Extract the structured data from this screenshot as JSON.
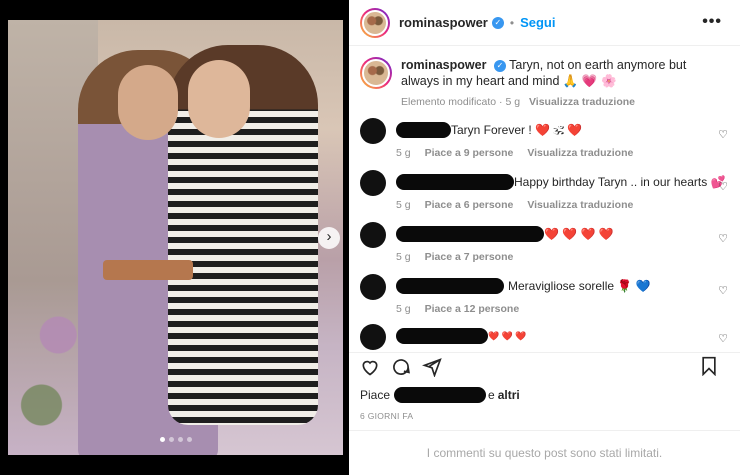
{
  "post": {
    "username": "rominaspower",
    "follow_label": "Segui",
    "separator": "•",
    "more_label": "•••"
  },
  "caption": {
    "username": "rominaspower",
    "text": "Taryn, not on earth anymore but always in my heart and mind 🙏 💗 🌸",
    "meta": "Elemento modificato · 5 g",
    "translate": "Visualizza traduzione"
  },
  "comments": [
    {
      "text": "Taryn Forever ! ❤️ 🕉 ❤️",
      "time": "5 g",
      "likes": "Piace a 9 persone",
      "translate": "Visualizza traduzione"
    },
    {
      "text": "Happy birthday Taryn .. in our hearts 💕",
      "time": "5 g",
      "likes": "Piace a 6 persone",
      "translate": "Visualizza traduzione"
    },
    {
      "text": "❤️ ❤️ ❤️ ❤️",
      "time": "5 g",
      "likes": "Piace a 7 persone",
      "translate": ""
    },
    {
      "text": "Meravigliose sorelle 🌹 💙",
      "time": "5 g",
      "likes": "Piace a 12 persone",
      "translate": ""
    },
    {
      "text": "❤️ ❤️ ❤️",
      "time": "",
      "likes": "",
      "translate": ""
    }
  ],
  "footer": {
    "likes_prefix": "Piace",
    "likes_suffix": "e",
    "likes_others": "altri",
    "date": "6 GIORNI FA",
    "limited": "I commenti su questo post sono stati limitati."
  },
  "carousel": {
    "current_slide": 1,
    "total_slides": 4,
    "next_icon": "chevron-right-icon"
  },
  "colors": {
    "accent": "#0095f6",
    "verified": "#3897f0",
    "heart": "#ed2d3f"
  }
}
